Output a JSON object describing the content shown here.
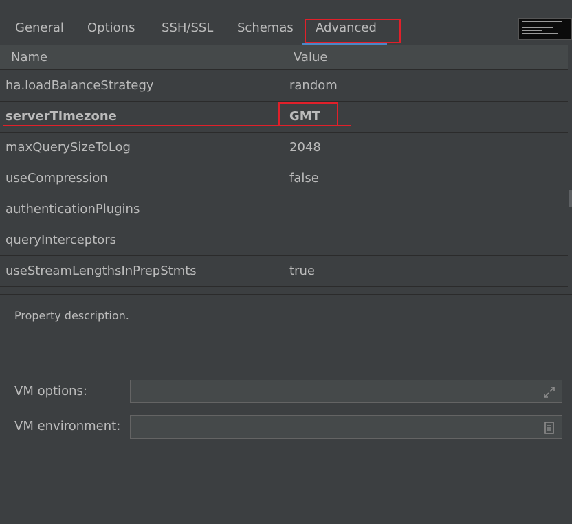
{
  "tabs": [
    {
      "label": "General"
    },
    {
      "label": "Options"
    },
    {
      "label": "SSH/SSL"
    },
    {
      "label": "Schemas"
    },
    {
      "label": "Advanced",
      "active": true
    }
  ],
  "table": {
    "headers": {
      "name": "Name",
      "value": "Value"
    },
    "rows": [
      {
        "name": "ha.loadBalanceStrategy",
        "value": "random"
      },
      {
        "name": "serverTimezone",
        "value": "GMT",
        "bold": true
      },
      {
        "name": "maxQuerySizeToLog",
        "value": "2048"
      },
      {
        "name": "useCompression",
        "value": "false"
      },
      {
        "name": "authenticationPlugins",
        "value": ""
      },
      {
        "name": "queryInterceptors",
        "value": ""
      },
      {
        "name": "useStreamLengthsInPrepStmts",
        "value": "true"
      }
    ]
  },
  "description": "Property description.",
  "vm": {
    "options_label": "VM options:",
    "options_value": "",
    "environment_label": "VM environment:",
    "environment_value": ""
  },
  "colors": {
    "background": "#3c3f41",
    "header": "#45494a",
    "text": "#bbbbbb",
    "accent": "#4a88c7",
    "highlight": "#e0202a"
  },
  "icons": {
    "vm_options": "expand-icon",
    "vm_environment": "document-icon"
  }
}
